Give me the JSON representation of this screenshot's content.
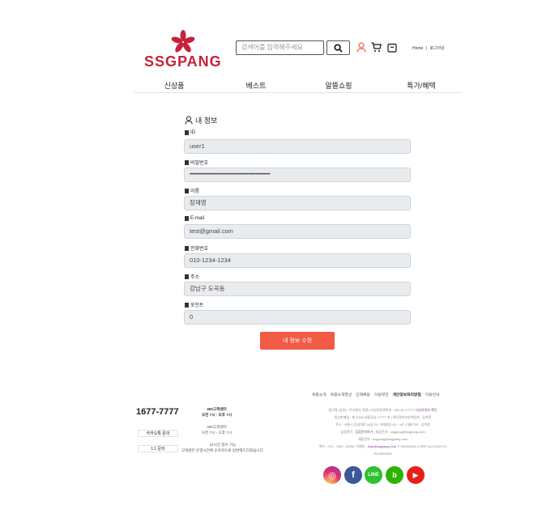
{
  "header": {
    "logo_text": "SSGPANG",
    "search_placeholder": "검색어를 입력해주세요",
    "home": "Home",
    "sep": "|",
    "logout": "로그아웃"
  },
  "nav": [
    "신상품",
    "베스트",
    "알뜰쇼핑",
    "특가/혜택"
  ],
  "form": {
    "title": "내 정보",
    "fields": [
      {
        "label": "ID",
        "value": "user1"
      },
      {
        "label": "비밀번호",
        "value": "••••••••••••••••••••••••••••••••••••••••••••••••••••••••••••••"
      },
      {
        "label": "이름",
        "value": "장재영"
      },
      {
        "label": "E-mail",
        "value": "test@gmail.com"
      },
      {
        "label": "전화번호",
        "value": "010-1234-1234"
      },
      {
        "label": "주소",
        "value": "강남구 도곡동"
      },
      {
        "label": "포인트",
        "value": "0"
      }
    ],
    "submit": "내 정보 수정"
  },
  "footer": {
    "phone": "1677-7777",
    "kakao": "카카오톡 문의",
    "one2one": "1:1 문의",
    "cs1_title": "365고객센터",
    "cs1_hours": "오전 7시 - 오후 7시",
    "cs2_title": "365고객센터",
    "cs2_hours": "오전 7시 - 오후 7시",
    "cs3_title": "24시간 접수 가능",
    "cs3_desc": "고객센터 운영시간에 순차적으로 답변해드리겠습니다.",
    "links": [
      "쓱팡소개",
      "쓱팡소개영상",
      "인재채용",
      "이용약관",
      "개인정보처리방침",
      "이용안내"
    ],
    "info": [
      "법인명 (상호) : 주식회사 쓱팡 | 사업자등록번호 : 261-81-77777",
      "사업자정보 확인",
      "통신판매업 : 제 2018-서울강남-77777 호 | 개인정보보호책임자 : 김쓱팡",
      "주소 : 서울시 강남대로 16길 20, 이래빌딩 B1 ~ 4F | 대표이사 : 김쓱팡",
      "입점문의 : ",
      "입점문의하기",
      " | 제휴문의 : ssgpang@ssgpang.com",
      "채용문의 : ssgpang@ssgpang.com",
      "팩스 : 070 - 7500 - 6098 | 이메일 : ",
      "help@ssgpang.com",
      " © SSGPANG CORP. ALL RIGHTS RESERVED"
    ],
    "social": [
      "instagram",
      "facebook",
      "line",
      "blog",
      "youtube"
    ]
  }
}
